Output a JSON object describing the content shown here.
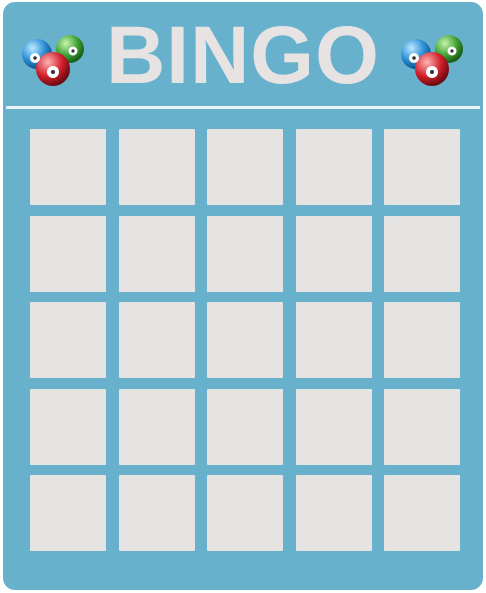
{
  "card": {
    "title": "BINGO",
    "accent_color": "#67b1cd",
    "cell_color": "#e6e3e3",
    "left_decoration": "lottery-balls-icon",
    "right_decoration": "lottery-balls-icon",
    "grid_rows": 5,
    "grid_columns": 5
  }
}
